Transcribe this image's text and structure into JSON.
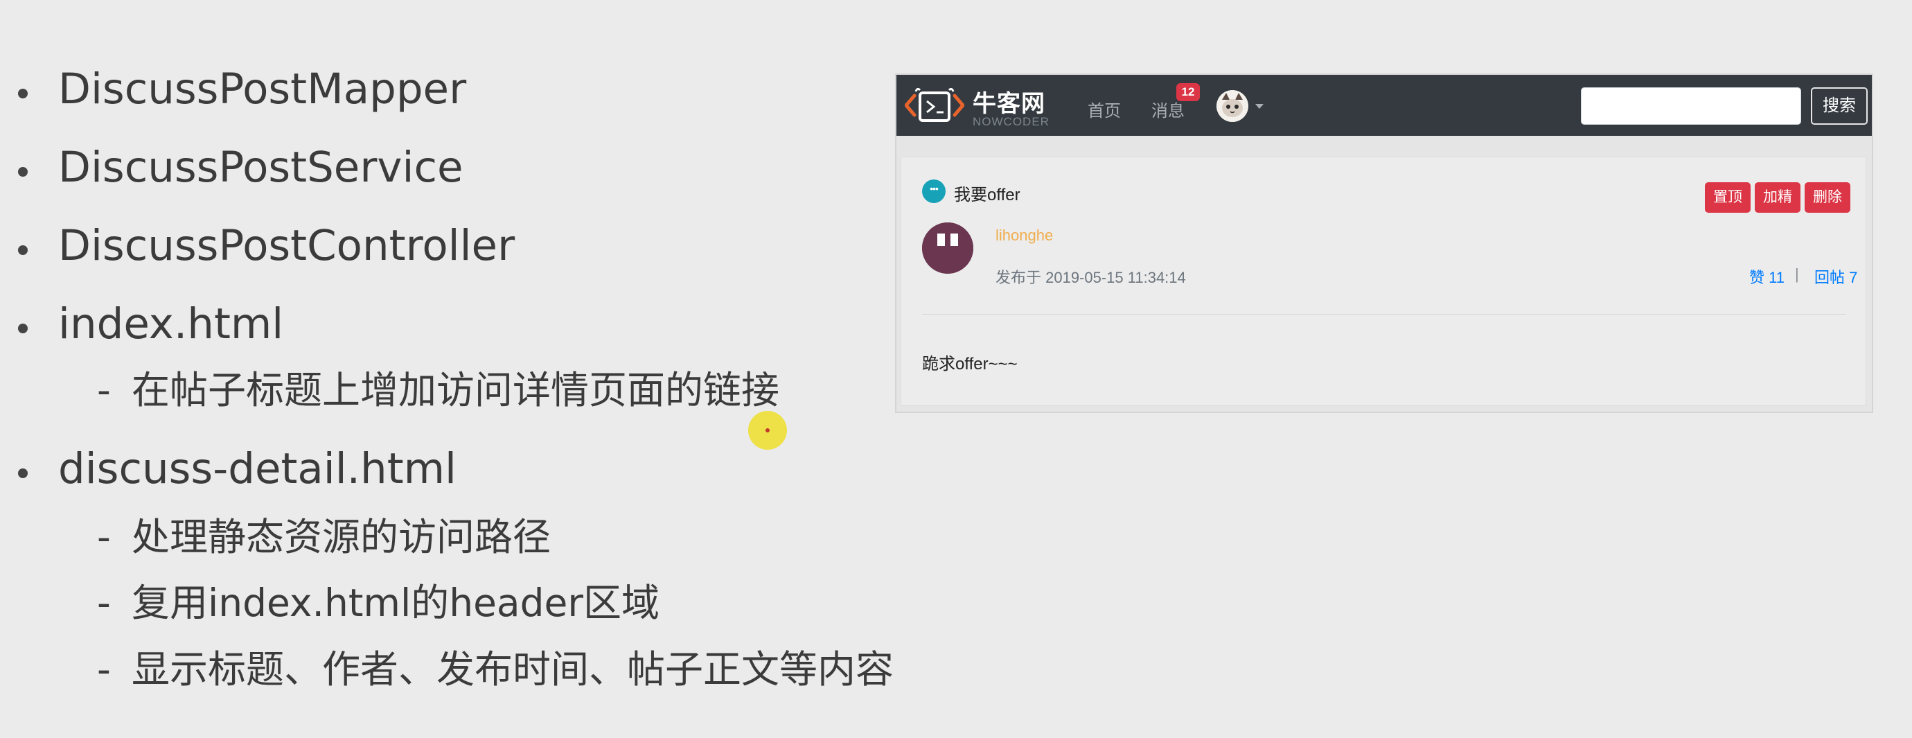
{
  "slide": {
    "bullets": [
      {
        "text": "DiscussPostMapper",
        "subs": []
      },
      {
        "text": "DiscussPostService",
        "subs": []
      },
      {
        "text": "DiscussPostController",
        "subs": []
      },
      {
        "text": "index.html",
        "subs": [
          "在帖子标题上增加访问详情页面的链接"
        ]
      },
      {
        "text": "discuss-detail.html",
        "subs": [
          "处理静态资源的访问路径",
          "复用index.html的header区域",
          "显示标题、作者、发布时间、帖子正文等内容"
        ]
      }
    ],
    "sub_dash": "-"
  },
  "screenshot": {
    "navbar": {
      "logo_text": "牛客网",
      "logo_sub": "NOWCODER",
      "nav_home": "首页",
      "nav_messages": "消息",
      "message_count": "12",
      "search_placeholder": "",
      "search_button": "搜索"
    },
    "post": {
      "title": "我要offer",
      "buttons": {
        "top": "置顶",
        "highlight": "加精",
        "delete": "删除"
      },
      "author": "lihonghe",
      "time": "发布于 2019-05-15 11:34:14",
      "likes": "赞 11",
      "separator": "|",
      "replies": "回帖 7",
      "body": "跪求offer~~~"
    },
    "colors": {
      "navbar": "#343a40",
      "danger": "#dc3545",
      "link": "#007bff",
      "author": "#f0ad4e",
      "icon": "#17a2b8"
    }
  }
}
